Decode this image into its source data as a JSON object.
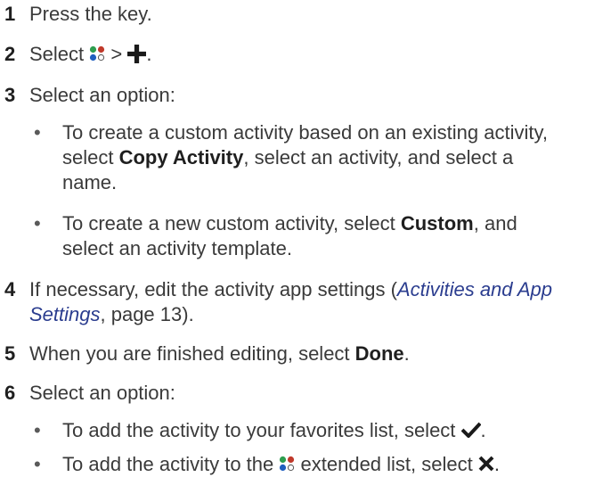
{
  "steps": {
    "s1": {
      "num": "1",
      "text": "Press the key."
    },
    "s2": {
      "num": "2",
      "before": "Select",
      "sep": ">",
      "after": "."
    },
    "s3": {
      "num": "3",
      "text": "Select an option:"
    },
    "s3b1": {
      "l1a": "To create a custom activity based on an existing activity,",
      "l2a": "select ",
      "l2b": "Copy Activity",
      "l2c": ", select an activity, and select a",
      "l3": "name."
    },
    "s3b2": {
      "l1a": "To create a new custom activity, select ",
      "l1b": "Custom",
      "l1c": ", and",
      "l2": "select an activity template."
    },
    "s4": {
      "num": "4",
      "a": "If necessary, edit the activity app settings (",
      "link1": "Activities and App",
      "link2": "Settings",
      "b": ", page 13)."
    },
    "s5": {
      "num": "5",
      "a": "When you are finished editing, select ",
      "bold": "Done",
      "c": "."
    },
    "s6": {
      "num": "6",
      "text": "Select an option:"
    },
    "s6b1": {
      "a": "To add the activity to your favorites list, select",
      "b": "."
    },
    "s6b2": {
      "a": "To add the activity to the",
      "b": "extended list, select",
      "c": "."
    }
  },
  "bullet_char": "•",
  "colors": {
    "text": "#3a3a3a",
    "link": "#2b3d8f",
    "apps_icon_dots": [
      "#2e9e4f",
      "#c0392b",
      "#1f5fbf",
      "#ffffff"
    ]
  },
  "icons": {
    "apps": "apps-menu-icon",
    "add": "plus-icon",
    "check": "checkmark-icon",
    "close": "x-icon"
  }
}
